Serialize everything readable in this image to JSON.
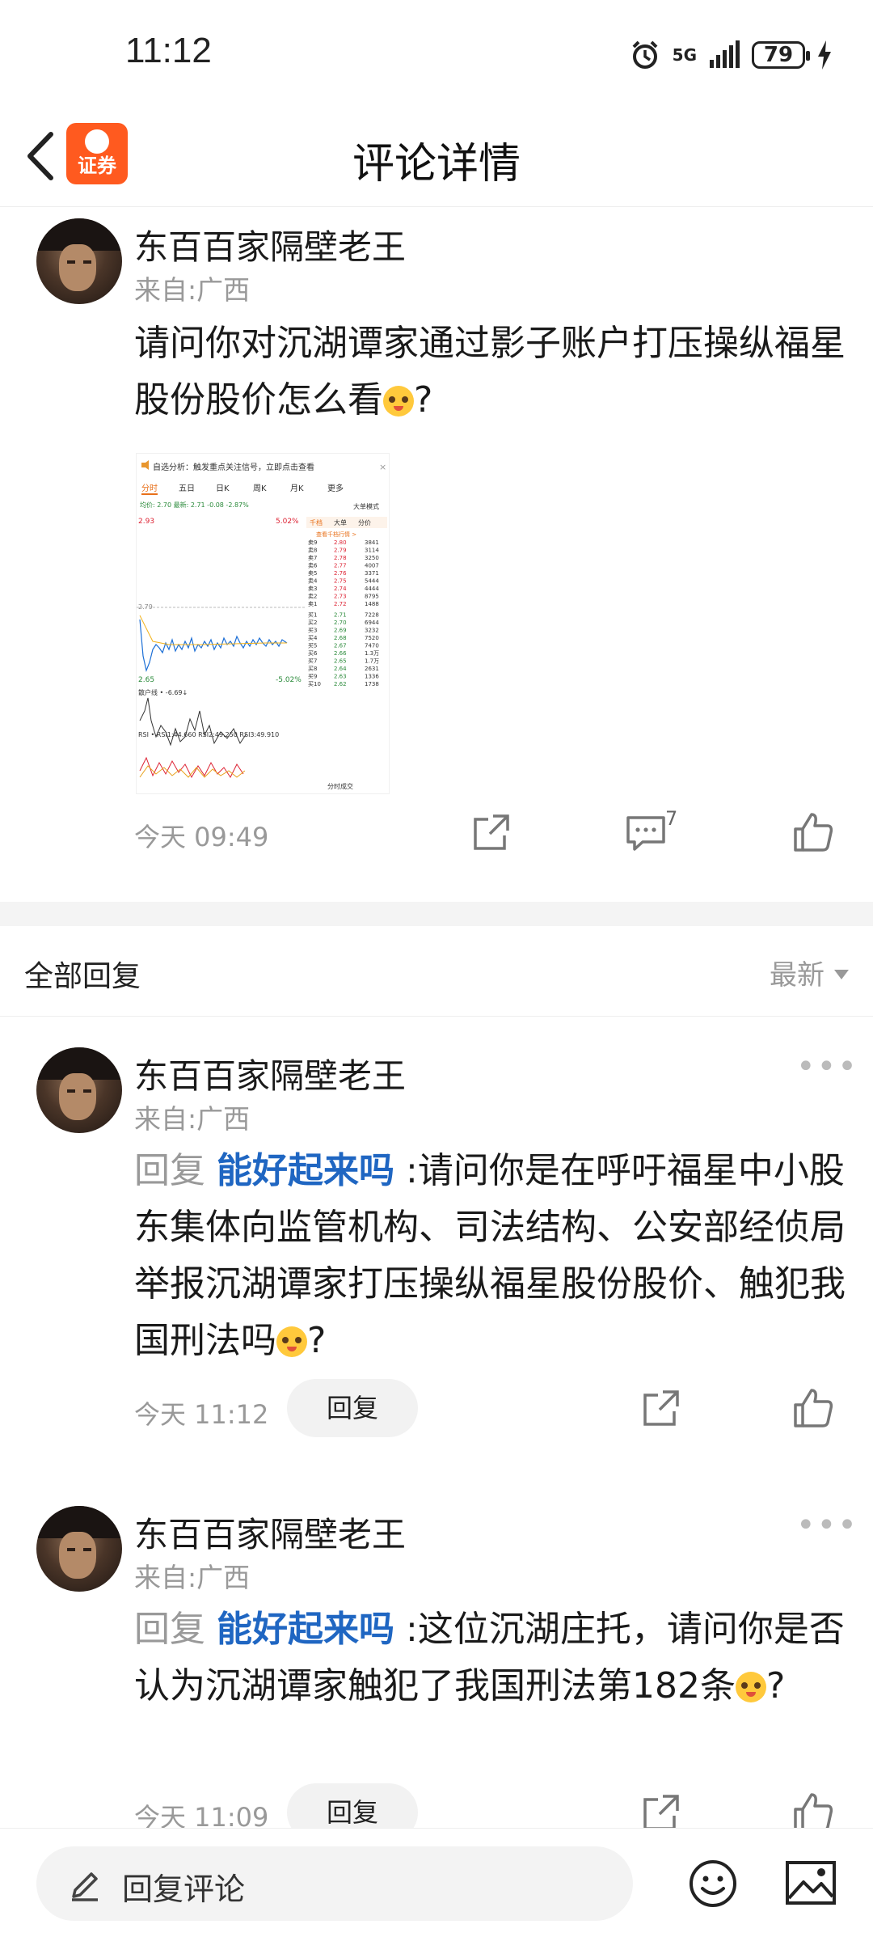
{
  "status": {
    "time": "11:12",
    "network": "5G",
    "battery": "79"
  },
  "nav": {
    "title": "评论详情",
    "app_logo_text": "证券"
  },
  "post": {
    "author": "东百百家隔壁老王",
    "from": "来自:广西",
    "text": "请问你对沉湖谭家通过影子账户打压操纵福星股份股价怎么看",
    "suffix": "?",
    "time": "今天 09:49",
    "comment_count": "7",
    "image": {
      "banner": "自选分析：触发重点关注信号，立即点击查看",
      "tabs": [
        "分时",
        "五日",
        "日K",
        "周K",
        "月K",
        "更多"
      ],
      "mode": "大单模式",
      "price_line": "均价: 2.70 最新: 2.71 -0.08 -2.87%",
      "high": "2.93",
      "high_pct": "5.02%",
      "low": "2.65",
      "low_pct": "-5.02%",
      "mid": "2.79",
      "side_tabs": [
        "千档",
        "大单",
        "分价"
      ],
      "side_title": "查看千档行情 >",
      "asks": [
        [
          "卖9",
          "2.80",
          "3841"
        ],
        [
          "卖8",
          "2.79",
          "3114"
        ],
        [
          "卖7",
          "2.78",
          "3250"
        ],
        [
          "卖6",
          "2.77",
          "4007"
        ],
        [
          "卖5",
          "2.76",
          "3371"
        ],
        [
          "卖4",
          "2.75",
          "5444"
        ],
        [
          "卖3",
          "2.74",
          "4444"
        ],
        [
          "卖2",
          "2.73",
          "8795"
        ],
        [
          "卖1",
          "2.72",
          "1488"
        ]
      ],
      "bids": [
        [
          "买1",
          "2.71",
          "7228"
        ],
        [
          "买2",
          "2.70",
          "6944"
        ],
        [
          "买3",
          "2.69",
          "3232"
        ],
        [
          "买4",
          "2.68",
          "7520"
        ],
        [
          "买5",
          "2.67",
          "7470"
        ],
        [
          "买6",
          "2.66",
          "1.3万"
        ],
        [
          "买7",
          "2.65",
          "1.7万"
        ],
        [
          "买8",
          "2.64",
          "2631"
        ],
        [
          "买9",
          "2.63",
          "1336"
        ],
        [
          "买10",
          "2.62",
          "1738"
        ]
      ],
      "indicator1": "散户线 • -6.69↓",
      "rsi": "RSI • RSI1:44.660 RSI2:49.250 RSI3:49.910",
      "footer": "分时成交"
    }
  },
  "replies_section": {
    "title": "全部回复",
    "sort": "最新"
  },
  "replies": [
    {
      "author": "东百百家隔壁老王",
      "from": "来自:广西",
      "prefix": "回复",
      "target": "能好起来吗",
      "text": ":请问你是在呼吁福星中小股东集体向监管机构、司法结构、公安部经侦局举报沉湖谭家打压操纵福星股份股价、触犯我国刑法吗",
      "suffix": "?",
      "time": "今天 11:12",
      "reply_label": "回复"
    },
    {
      "author": "东百百家隔壁老王",
      "from": "来自:广西",
      "prefix": "回复",
      "target": "能好起来吗",
      "text": ":这位沉湖庄托，请问你是否认为沉湖谭家触犯了我国刑法第182条",
      "suffix": "?",
      "time": "今天 11:09",
      "reply_label": "回复"
    }
  ],
  "bottom": {
    "placeholder": "回复评论"
  }
}
